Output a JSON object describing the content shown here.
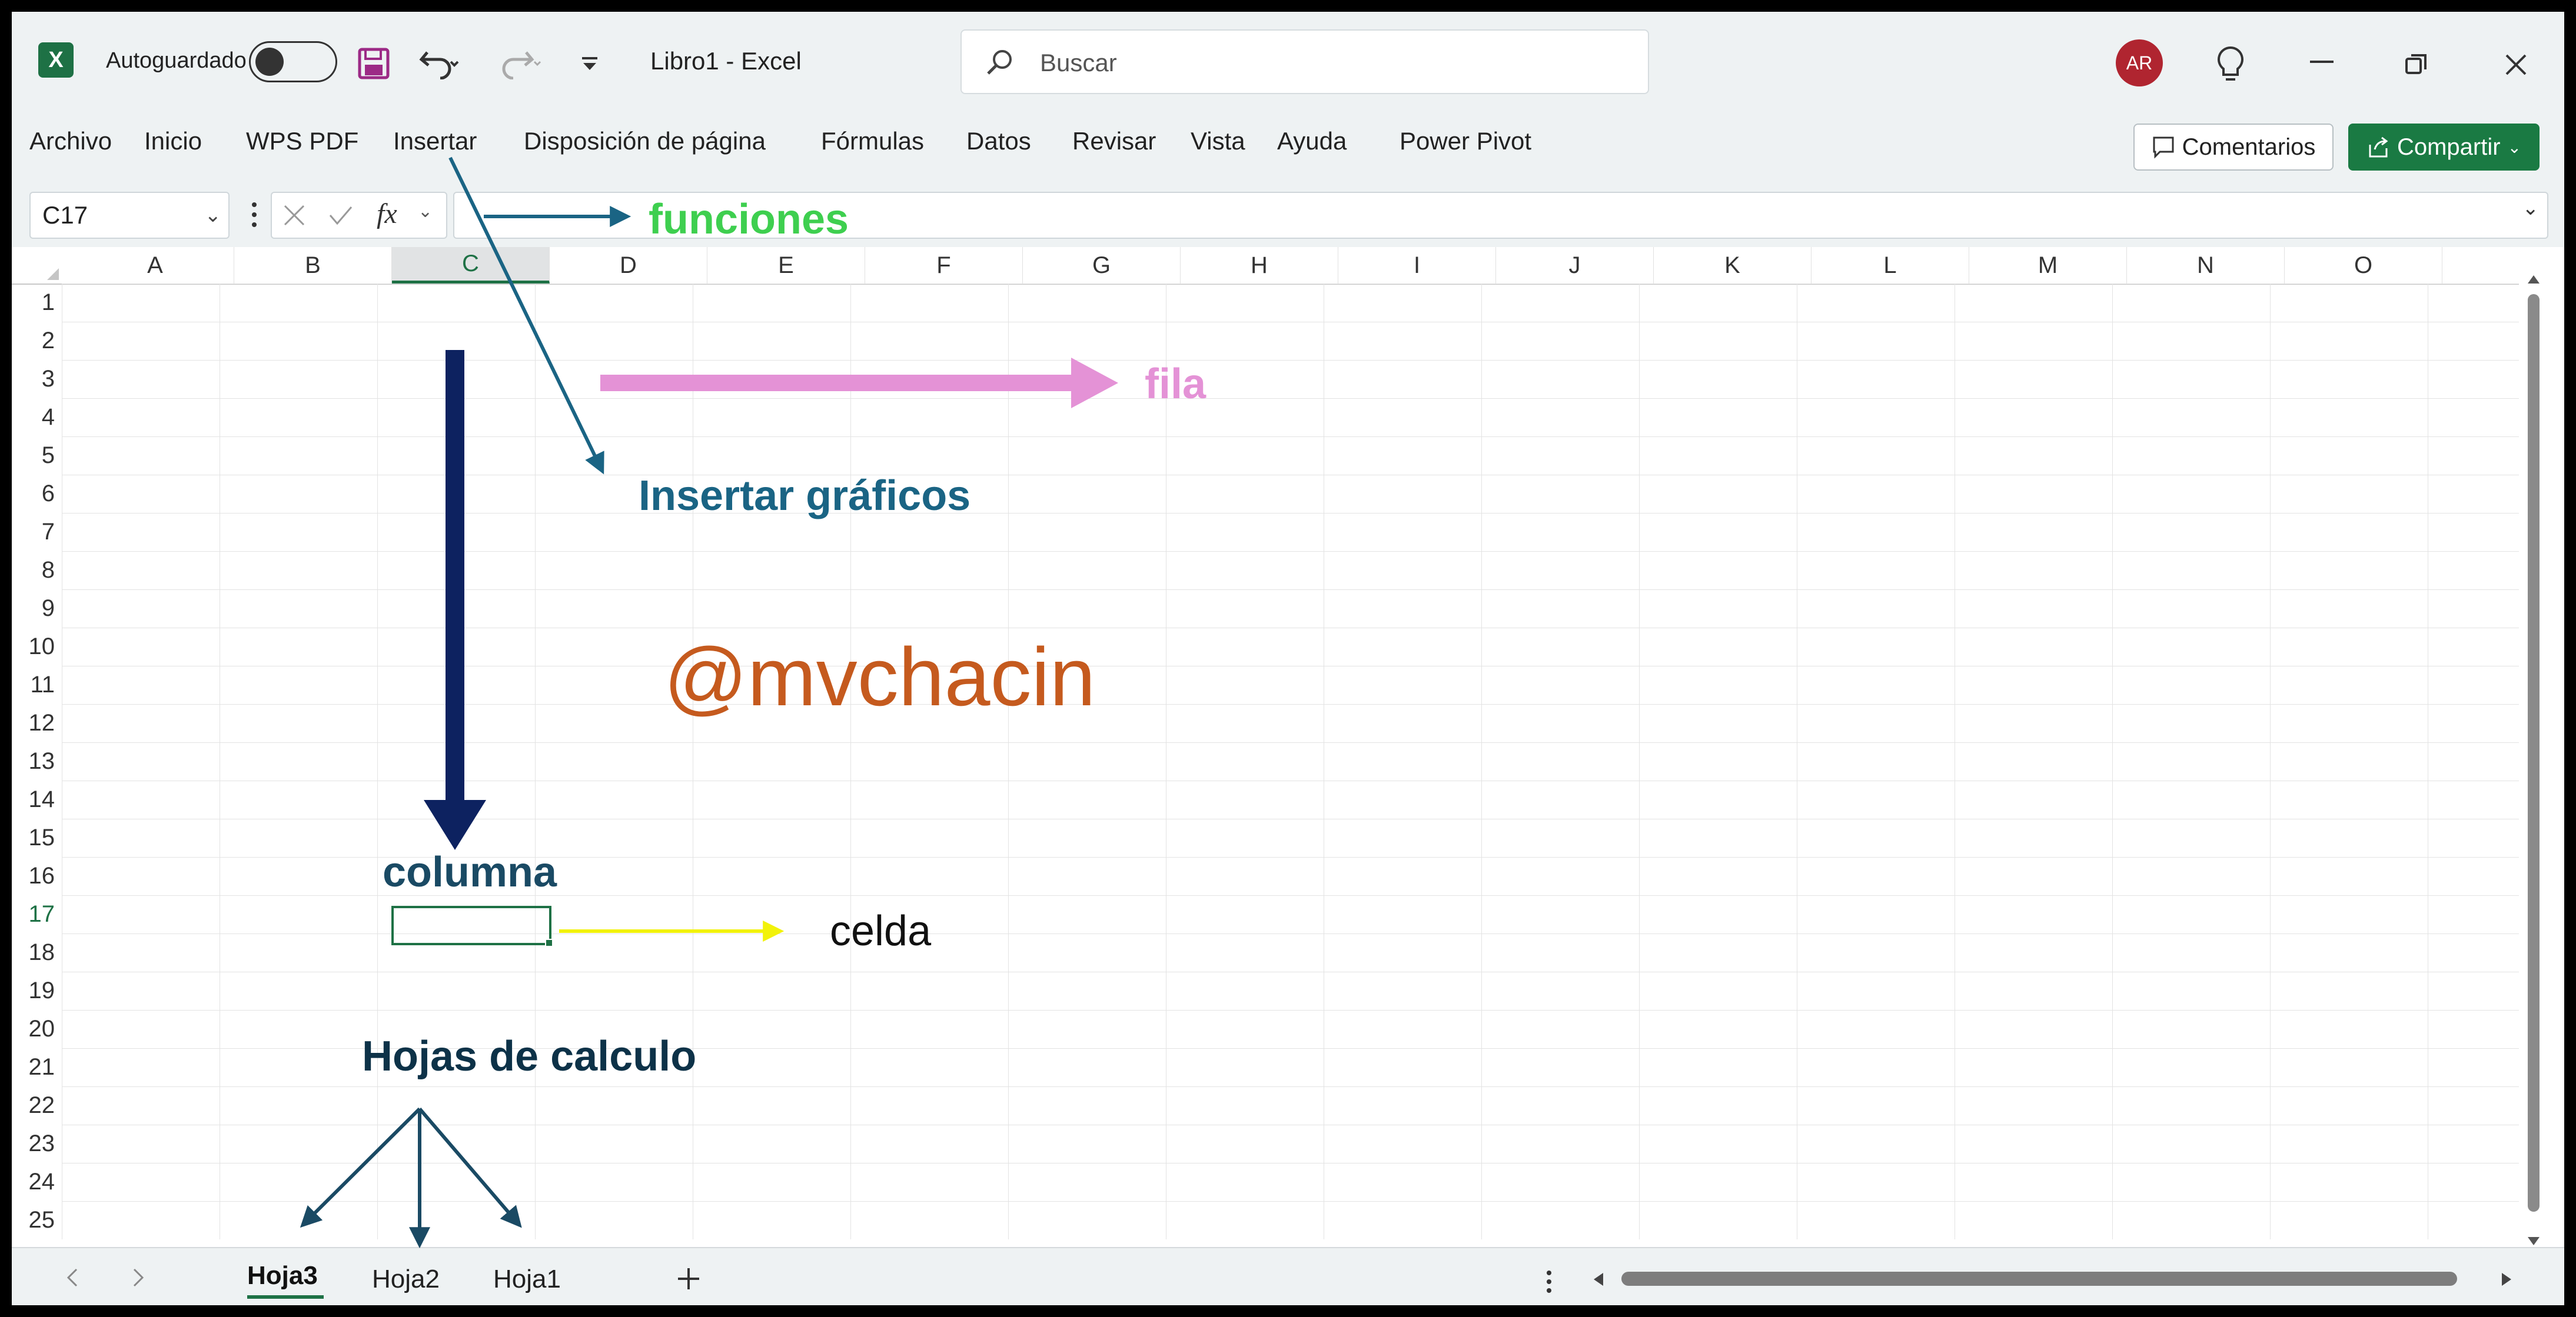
{
  "titlebar": {
    "autosave_label": "Autoguardado",
    "file_title": "Libro1  -  Excel",
    "search_placeholder": "Buscar",
    "avatar_initials": "AR"
  },
  "ribbon": {
    "tabs": [
      "Archivo",
      "Inicio",
      "WPS PDF",
      "Insertar",
      "Disposición de página",
      "Fórmulas",
      "Datos",
      "Revisar",
      "Vista",
      "Ayuda",
      "Power Pivot"
    ],
    "comments_label": "Comentarios",
    "share_label": "Compartir"
  },
  "formula_bar": {
    "name_box": "C17",
    "fx_label": "fx",
    "formula_value": ""
  },
  "grid": {
    "columns": [
      "A",
      "B",
      "C",
      "D",
      "E",
      "F",
      "G",
      "H",
      "I",
      "J",
      "K",
      "L",
      "M",
      "N",
      "O"
    ],
    "rows": [
      "1",
      "2",
      "3",
      "4",
      "5",
      "6",
      "7",
      "8",
      "9",
      "10",
      "11",
      "12",
      "13",
      "14",
      "15",
      "16",
      "17",
      "18",
      "19",
      "20",
      "21",
      "22",
      "23",
      "24",
      "25"
    ],
    "selected_cell": "C17"
  },
  "sheets": {
    "tabs": [
      "Hoja3",
      "Hoja2",
      "Hoja1"
    ],
    "active": "Hoja3"
  },
  "annotations": {
    "funciones": "funciones",
    "fila": "fila",
    "insertar_graficos": "Insertar gráficos",
    "watermark": "@mvchacin",
    "columna": "columna",
    "celda": "celda",
    "hojas": "Hojas de calculo"
  },
  "colors": {
    "excel_green": "#1e7145",
    "share_green": "#1a7a43",
    "funciones": "#3ecf4f",
    "fila": "#e492d6",
    "insertar": "#1a6484",
    "watermark": "#c55a1e",
    "columna_arrow": "#0d2260",
    "celda_arrow": "#f2f20a",
    "hojas": "#0d3248"
  }
}
